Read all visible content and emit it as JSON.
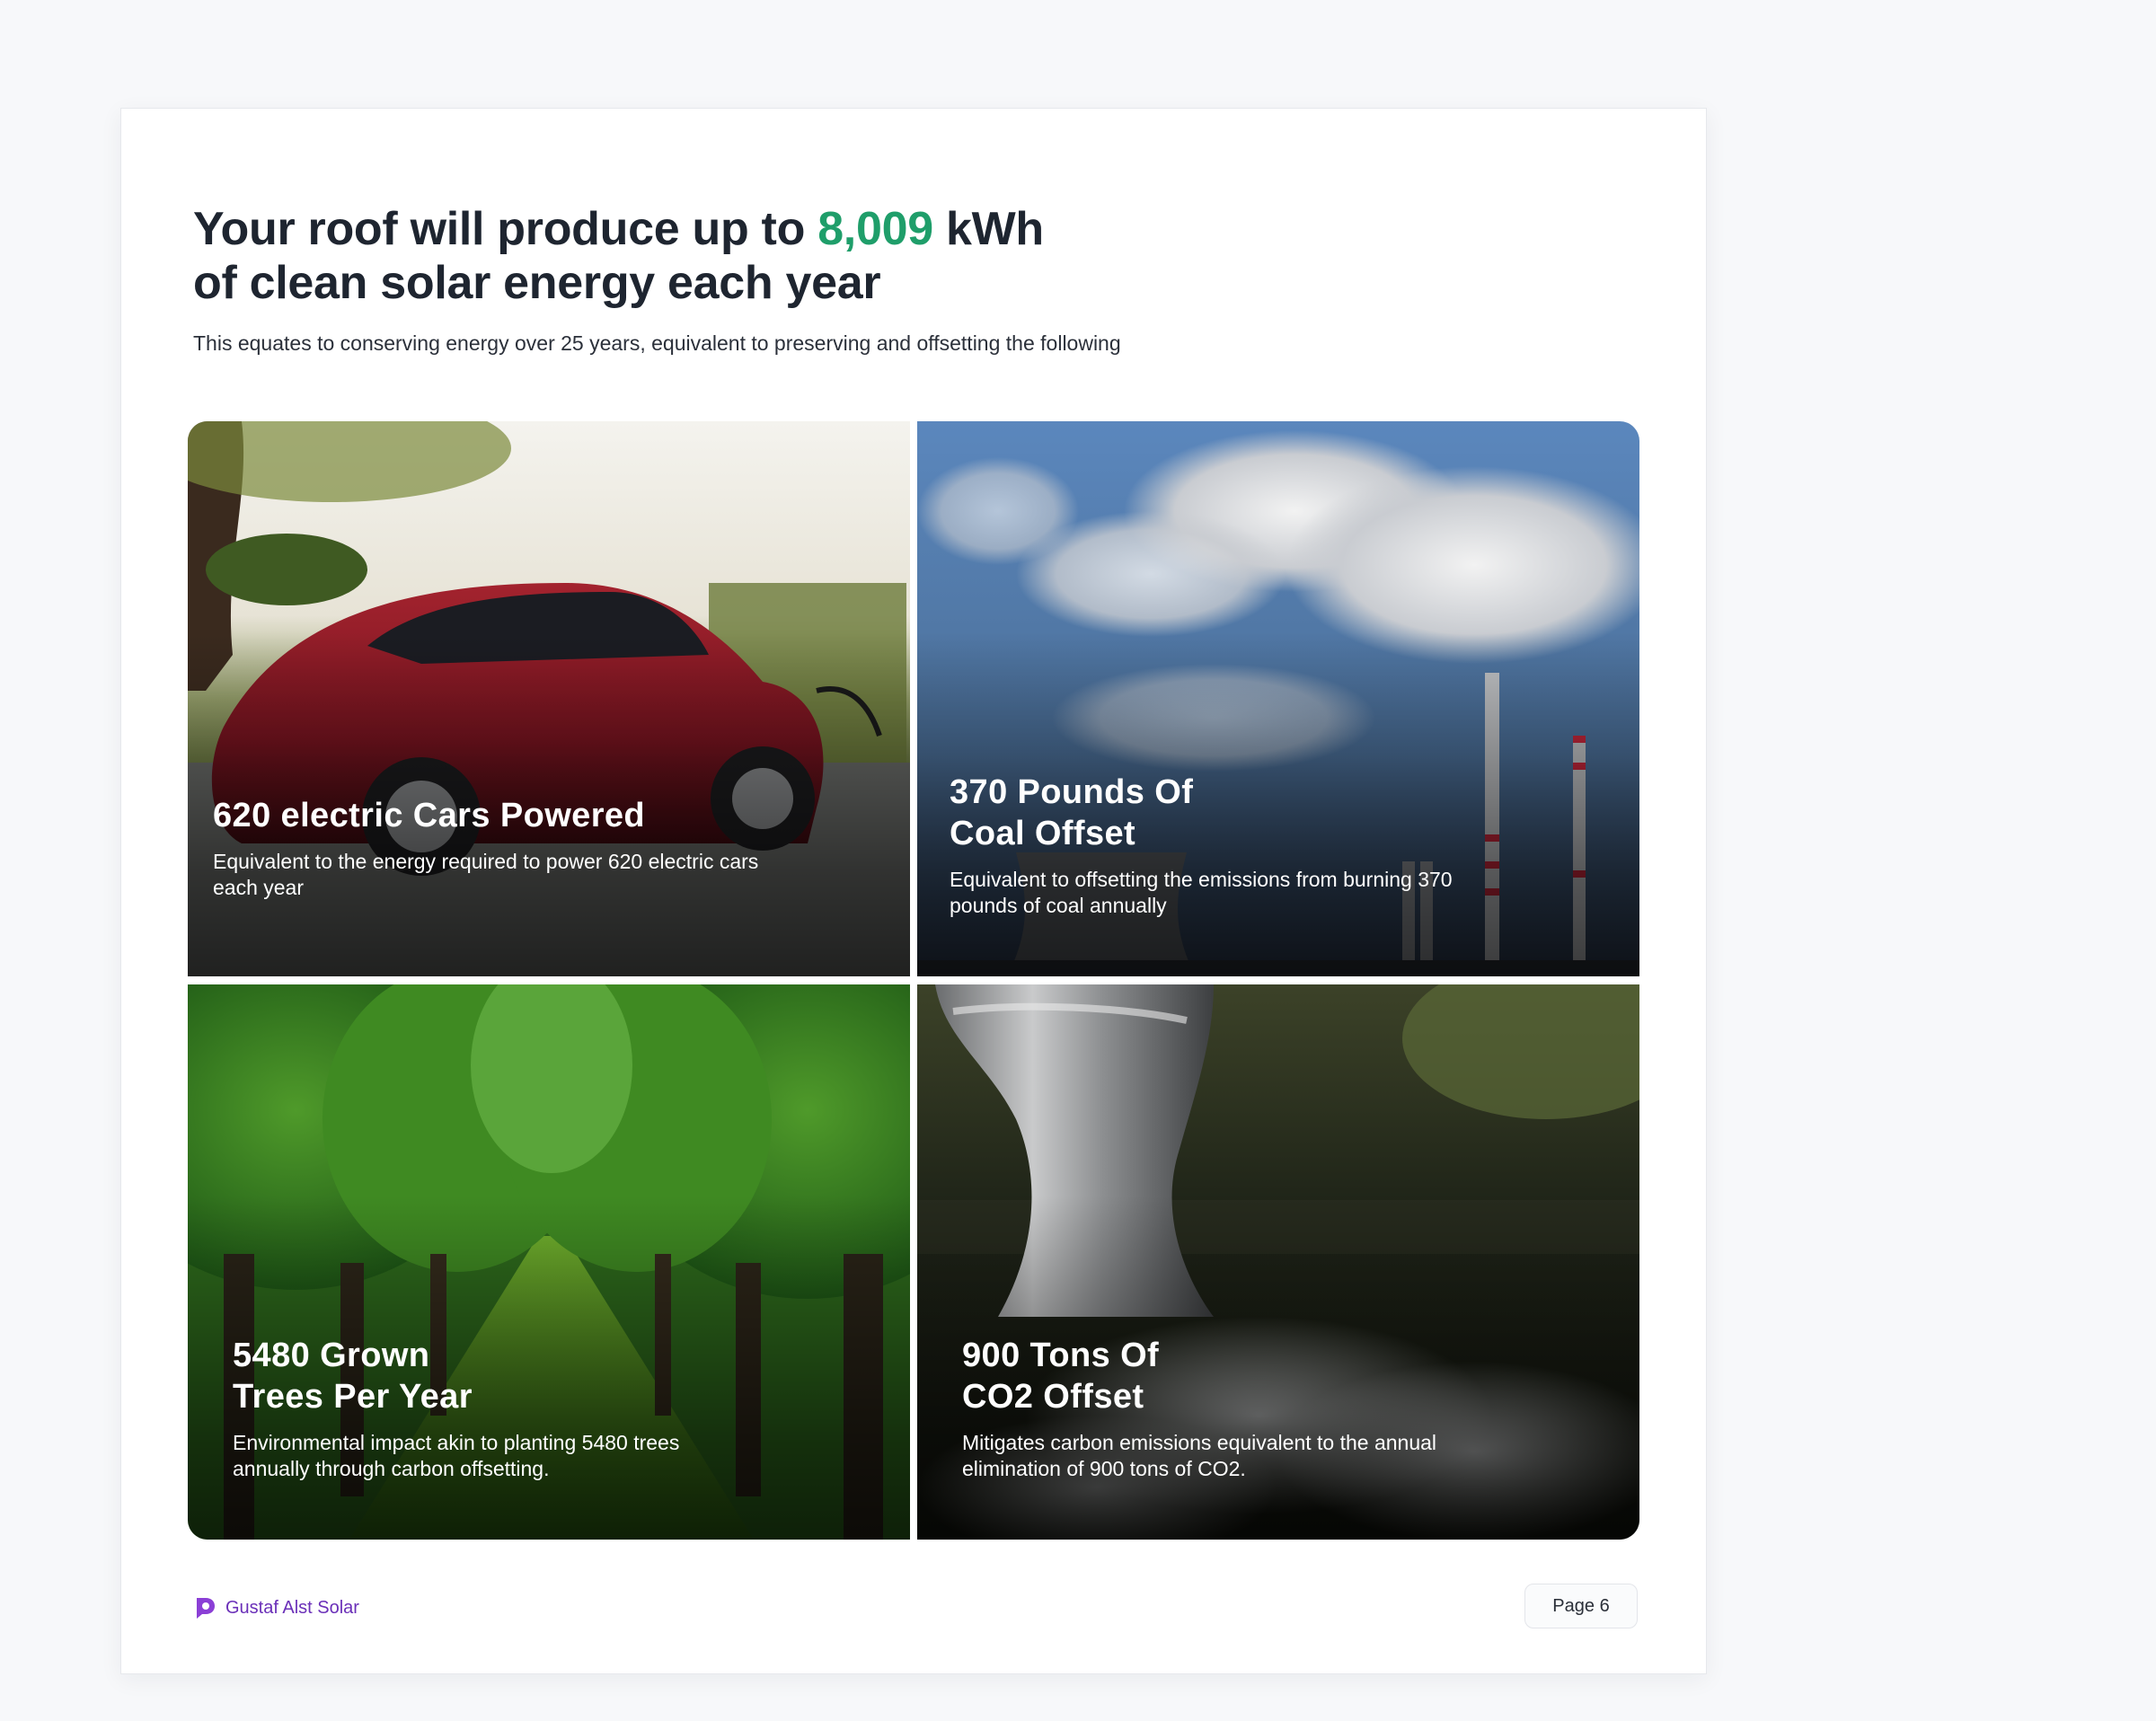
{
  "header": {
    "title_prefix": "Your roof will produce up to ",
    "title_value": "8,009",
    "title_unit": " kWh",
    "title_line2": "of clean solar energy each year",
    "subtitle": "This equates to conserving energy over 25 years, equivalent to preserving and offsetting the following"
  },
  "tiles": [
    {
      "title": "620 electric Cars Powered",
      "description": "Equivalent to the energy required to power 620 electric cars each year",
      "icon": "electric-car-photo"
    },
    {
      "title": "370 Pounds Of\nCoal Offset",
      "description": "Equivalent to offsetting the emissions from burning 370 pounds of coal annually",
      "icon": "power-plant-smokestacks-photo"
    },
    {
      "title": "5480 Grown\nTrees Per Year",
      "description": "Environmental impact akin to planting 5480 trees annually through carbon offsetting.",
      "icon": "tree-avenue-photo"
    },
    {
      "title": "900 Tons  Of\nCO2  Offset",
      "description": "Mitigates carbon emissions equivalent to the annual elimination of 900 tons of CO2.",
      "icon": "exhaust-pipe-photo"
    }
  ],
  "footer": {
    "brand_name": "Gustaf Alst Solar",
    "page_label": "Page 6"
  },
  "colors": {
    "highlight": "#1f9e6a",
    "brand": "#6a2fb8",
    "heading": "#1e2530"
  }
}
